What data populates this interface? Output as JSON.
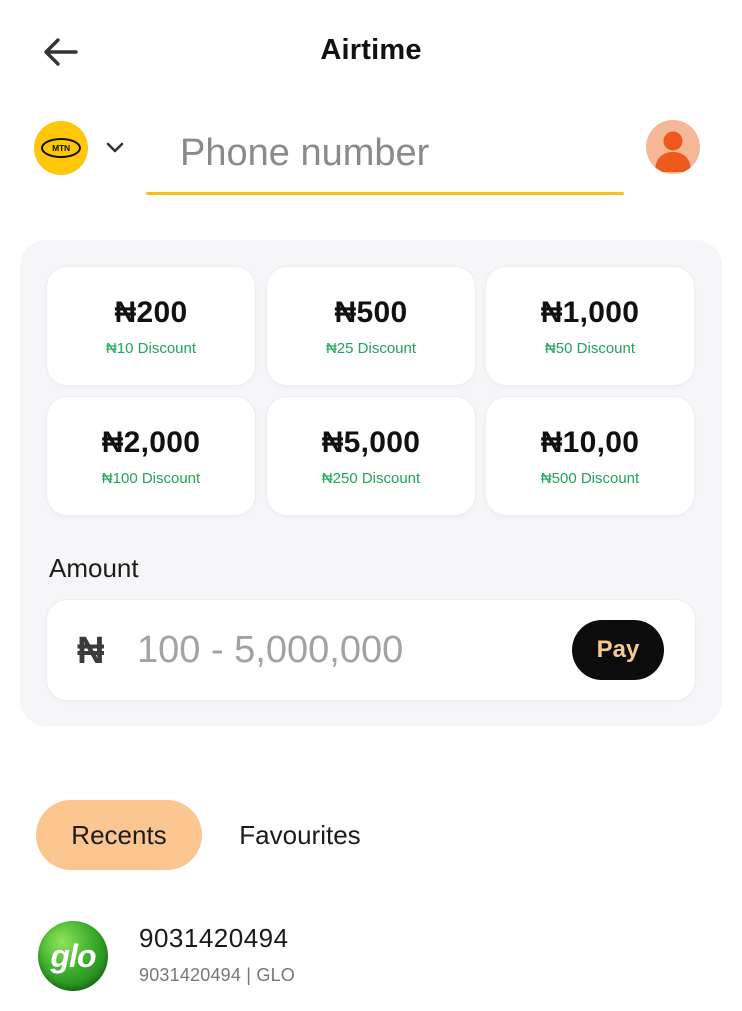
{
  "header": {
    "title": "Airtime",
    "back_icon": "arrow-left-icon"
  },
  "network": {
    "selected_logo_text": "MTN",
    "brand_color": "#ffc60a",
    "chevron_icon": "chevron-down-icon"
  },
  "phone": {
    "placeholder": "Phone number",
    "value": "",
    "underline_color": "#f4c11f",
    "contact_icon": "person-icon"
  },
  "quick_amounts": [
    {
      "amount": "₦200",
      "discount": "₦10 Discount"
    },
    {
      "amount": "₦500",
      "discount": "₦25 Discount"
    },
    {
      "amount": "₦1,000",
      "discount": "₦50 Discount"
    },
    {
      "amount": "₦2,000",
      "discount": "₦100 Discount"
    },
    {
      "amount": "₦5,000",
      "discount": "₦250 Discount"
    },
    {
      "amount": "₦10,00",
      "discount": "₦500 Discount"
    }
  ],
  "amount": {
    "label": "Amount",
    "currency_symbol": "₦",
    "placeholder": "100 - 5,000,000",
    "value": "",
    "pay_label": "Pay"
  },
  "tabs": [
    {
      "label": "Recents",
      "active": true
    },
    {
      "label": "Favourites",
      "active": false
    }
  ],
  "recents": [
    {
      "logo_text": "glo",
      "number": "9031420494",
      "subtitle": "9031420494 | GLO"
    }
  ],
  "colors": {
    "discount": "#22a45a",
    "active_tab": "#fbc690",
    "pay_button_bg": "#0c0c0c",
    "pay_button_text": "#f6c78e"
  }
}
